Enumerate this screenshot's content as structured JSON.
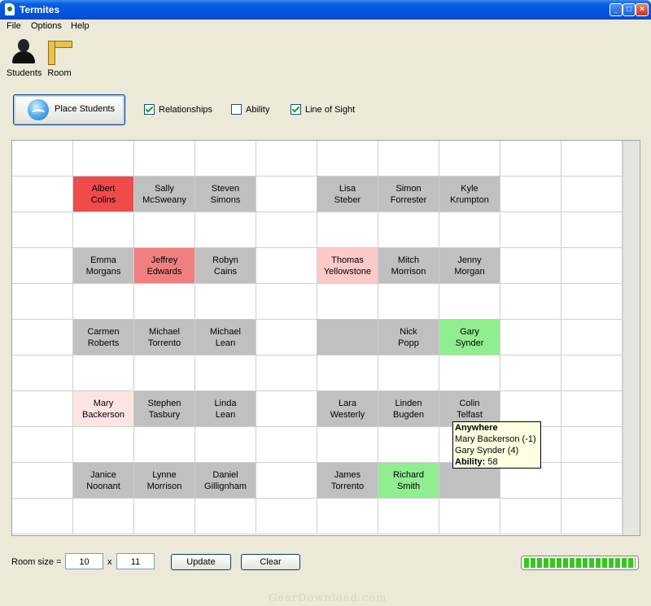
{
  "window": {
    "title": "Termites"
  },
  "menu": [
    "File",
    "Options",
    "Help"
  ],
  "toolbar": {
    "students": "Students",
    "room": "Room"
  },
  "controls": {
    "place_button": "Place Students",
    "relationships": {
      "label": "Relationships",
      "checked": true
    },
    "ability": {
      "label": "Ability",
      "checked": false
    },
    "line_of_sight": {
      "label": "Line of Sight",
      "checked": true
    }
  },
  "grid": {
    "rows": 11,
    "cols": 10,
    "desks": [
      {
        "row": 1,
        "col": 1,
        "first": "Albert",
        "last": "Colins",
        "color": "red"
      },
      {
        "row": 1,
        "col": 2,
        "first": "Sally",
        "last": "McSweany",
        "color": "desk"
      },
      {
        "row": 1,
        "col": 3,
        "first": "Steven",
        "last": "Simons",
        "color": "desk"
      },
      {
        "row": 1,
        "col": 5,
        "first": "Lisa",
        "last": "Steber",
        "color": "desk"
      },
      {
        "row": 1,
        "col": 6,
        "first": "Simon",
        "last": "Forrester",
        "color": "desk"
      },
      {
        "row": 1,
        "col": 7,
        "first": "Kyle",
        "last": "Krumpton",
        "color": "desk"
      },
      {
        "row": 3,
        "col": 1,
        "first": "Emma",
        "last": "Morgans",
        "color": "desk"
      },
      {
        "row": 3,
        "col": 2,
        "first": "Jeffrey",
        "last": "Edwards",
        "color": "salmon"
      },
      {
        "row": 3,
        "col": 3,
        "first": "Robyn",
        "last": "Cains",
        "color": "desk"
      },
      {
        "row": 3,
        "col": 5,
        "first": "Thomas",
        "last": "Yellowstone",
        "color": "pink"
      },
      {
        "row": 3,
        "col": 6,
        "first": "Mitch",
        "last": "Morrison",
        "color": "desk"
      },
      {
        "row": 3,
        "col": 7,
        "first": "Jenny",
        "last": "Morgan",
        "color": "desk"
      },
      {
        "row": 5,
        "col": 1,
        "first": "Carmen",
        "last": "Roberts",
        "color": "desk"
      },
      {
        "row": 5,
        "col": 2,
        "first": "Michael",
        "last": "Torrento",
        "color": "desk"
      },
      {
        "row": 5,
        "col": 3,
        "first": "Michael",
        "last": "Lean",
        "color": "desk"
      },
      {
        "row": 5,
        "col": 5,
        "first": "",
        "last": "",
        "color": "desk"
      },
      {
        "row": 5,
        "col": 6,
        "first": "Nick",
        "last": "Popp",
        "color": "desk"
      },
      {
        "row": 5,
        "col": 7,
        "first": "Gary",
        "last": "Synder",
        "color": "green"
      },
      {
        "row": 7,
        "col": 1,
        "first": "Mary",
        "last": "Backerson",
        "color": "lightpink"
      },
      {
        "row": 7,
        "col": 2,
        "first": "Stephen",
        "last": "Tasbury",
        "color": "desk"
      },
      {
        "row": 7,
        "col": 3,
        "first": "Linda",
        "last": "Lean",
        "color": "desk"
      },
      {
        "row": 7,
        "col": 5,
        "first": "Lara",
        "last": "Westerly",
        "color": "desk"
      },
      {
        "row": 7,
        "col": 6,
        "first": "Linden",
        "last": "Bugden",
        "color": "desk"
      },
      {
        "row": 7,
        "col": 7,
        "first": "Colin",
        "last": "Telfast",
        "color": "desk"
      },
      {
        "row": 9,
        "col": 1,
        "first": "Janice",
        "last": "Noonant",
        "color": "desk"
      },
      {
        "row": 9,
        "col": 2,
        "first": "Lynne",
        "last": "Morrison",
        "color": "desk"
      },
      {
        "row": 9,
        "col": 3,
        "first": "Daniel",
        "last": "Gillignham",
        "color": "desk"
      },
      {
        "row": 9,
        "col": 5,
        "first": "James",
        "last": "Torrento",
        "color": "desk"
      },
      {
        "row": 9,
        "col": 6,
        "first": "Richard",
        "last": "Smith",
        "color": "green"
      },
      {
        "row": 9,
        "col": 7,
        "first": "",
        "last": "",
        "color": "desk"
      }
    ]
  },
  "tooltip": {
    "title": "Anywhere",
    "line1": "Mary Backerson (-1)",
    "line2": "Gary Synder (4)",
    "ability_label": "Ability:",
    "ability_value": "58"
  },
  "bottom": {
    "room_size_label": "Room size =",
    "width": "10",
    "times": "x",
    "height": "11",
    "update": "Update",
    "clear": "Clear",
    "progress": 1.0
  },
  "watermark": "GearDownload.com"
}
